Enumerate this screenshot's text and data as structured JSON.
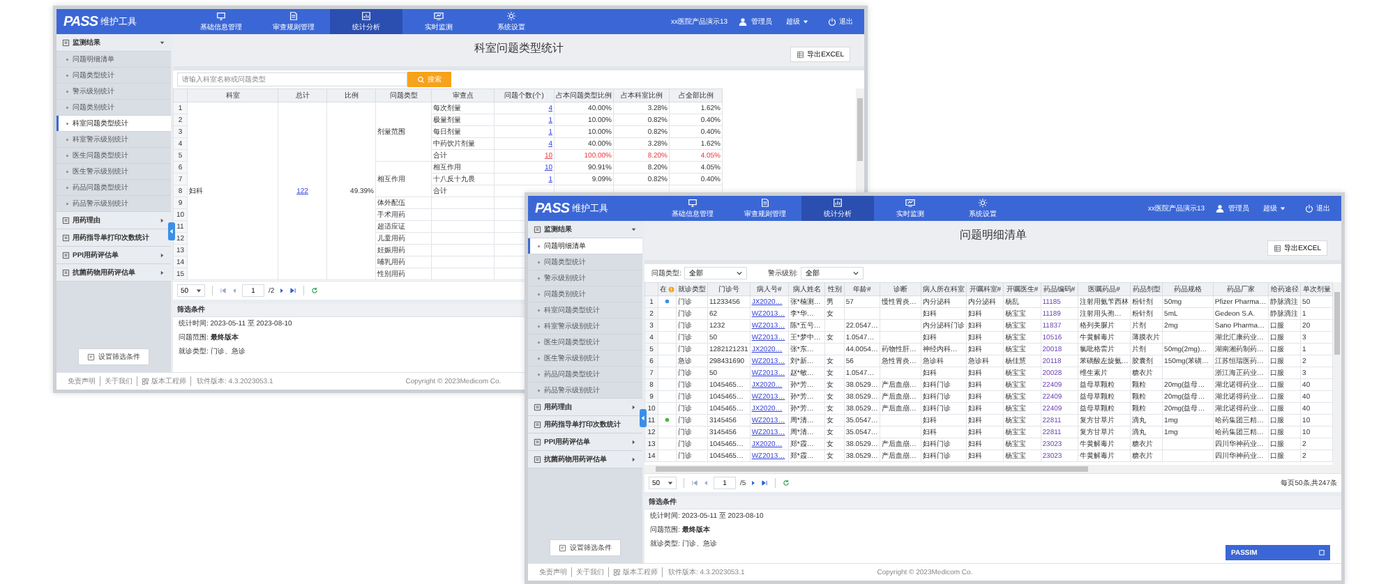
{
  "windows": [
    {
      "kind": "summary",
      "header": {
        "logo_mark": "PASS",
        "logo_text": "维护工具",
        "tabs": [
          {
            "label": "基础信息管理",
            "selected": false
          },
          {
            "label": "审查规则管理",
            "selected": false
          },
          {
            "label": "统计分析",
            "selected": true
          },
          {
            "label": "实时监测",
            "selected": false
          },
          {
            "label": "系统设置",
            "selected": false
          }
        ],
        "hospital": "xx医院产品演示13",
        "user": "管理员",
        "role": "超级",
        "logout": "退出"
      },
      "sidebar": {
        "groups": [
          {
            "label": "监测结果",
            "kind": "folder",
            "expanded": true,
            "items": [
              {
                "label": "问题明细清单",
                "selected": false
              },
              {
                "label": "问题类型统计",
                "selected": false
              },
              {
                "label": "警示级别统计",
                "selected": false
              },
              {
                "label": "问题类别统计",
                "selected": false
              },
              {
                "label": "科室问题类型统计",
                "selected": true
              },
              {
                "label": "科室警示级别统计",
                "selected": false
              },
              {
                "label": "医生问题类型统计",
                "selected": false
              },
              {
                "label": "医生警示级别统计",
                "selected": false
              },
              {
                "label": "药品问题类型统计",
                "selected": false
              },
              {
                "label": "药品警示级别统计",
                "selected": false
              }
            ]
          },
          {
            "label": "用药理由",
            "kind": "folder",
            "expanded": false
          },
          {
            "label": "用药指导单打印次数统计",
            "kind": "page"
          },
          {
            "label": "PPI用药评估单",
            "kind": "folder",
            "expanded": false
          },
          {
            "label": "抗菌药物用药评估单",
            "kind": "folder",
            "expanded": false
          }
        ],
        "button": "设置筛选条件"
      },
      "title": "科室问题类型统计",
      "export": "导出EXCEL",
      "search": {
        "placeholder": "请输入科室名称或问题类型",
        "button": "搜索"
      },
      "table": {
        "columns": [
          "科室",
          "总计",
          "比例",
          "问题类型",
          "审查点",
          "问题个数(个)",
          "占本问题类型比例",
          "占本科室比例",
          "占全部比例"
        ],
        "department": "妇科",
        "total": "122",
        "ratio": "49.39%",
        "types": [
          {
            "name": "剂量范围",
            "rows": [
              {
                "no": "1",
                "point": "每次剂量",
                "count": "4",
                "pct_type": "40.00%",
                "pct_dept": "3.28%",
                "pct_all": "1.62%"
              },
              {
                "no": "2",
                "point": "极量剂量",
                "count": "1",
                "pct_type": "10.00%",
                "pct_dept": "0.82%",
                "pct_all": "0.40%"
              },
              {
                "no": "3",
                "point": "每日剂量",
                "count": "1",
                "pct_type": "10.00%",
                "pct_dept": "0.82%",
                "pct_all": "0.40%"
              },
              {
                "no": "4",
                "point": "中药饮片剂量",
                "count": "4",
                "pct_type": "40.00%",
                "pct_dept": "3.28%",
                "pct_all": "1.62%"
              },
              {
                "no": "5",
                "point": "合计",
                "count": "10",
                "pct_type": "100.00%",
                "pct_dept": "8.20%",
                "pct_all": "4.05%",
                "kind": "total"
              }
            ]
          },
          {
            "name": "相互作用",
            "rows": [
              {
                "no": "6",
                "point": "相互作用",
                "count": "10",
                "pct_type": "90.91%",
                "pct_dept": "8.20%",
                "pct_all": "4.05%"
              },
              {
                "no": "7",
                "point": "十八反十九畏",
                "count": "1",
                "pct_type": "9.09%",
                "pct_dept": "0.82%",
                "pct_all": "0.40%"
              },
              {
                "no": "8",
                "point": "合计"
              }
            ]
          },
          {
            "name": "体外配伍",
            "rows": [
              {
                "no": "9"
              }
            ]
          },
          {
            "name": "手术用药",
            "rows": [
              {
                "no": "10"
              }
            ]
          },
          {
            "name": "超适应证",
            "rows": [
              {
                "no": "11"
              }
            ]
          },
          {
            "name": "儿童用药",
            "rows": [
              {
                "no": "12"
              }
            ]
          },
          {
            "name": "妊娠用药",
            "rows": [
              {
                "no": "13"
              }
            ]
          },
          {
            "name": "哺乳用药",
            "rows": [
              {
                "no": "14"
              }
            ]
          },
          {
            "name": "性别用药",
            "rows": [
              {
                "no": "15"
              }
            ]
          }
        ]
      },
      "pager": {
        "size": "50",
        "page": "1",
        "pages": "/2"
      },
      "conditions": {
        "heading": "筛选条件",
        "lines": [
          "统计时间: 2023-05-11 至 2023-08-10",
          "问题范围: **最终版本**",
          "就诊类型: 门诊、急诊"
        ]
      },
      "footer": {
        "links": [
          "免责声明",
          "关于我们",
          "版本工程师"
        ],
        "version": "软件版本: 4.3.2023053.1",
        "copyright": "Copyright © 2023Medicom Co."
      }
    },
    {
      "kind": "detail",
      "header": {
        "logo_mark": "PASS",
        "logo_text": "维护工具",
        "tabs": [
          {
            "label": "基础信息管理",
            "selected": false
          },
          {
            "label": "审查规则管理",
            "selected": false
          },
          {
            "label": "统计分析",
            "selected": true
          },
          {
            "label": "实时监测",
            "selected": false
          },
          {
            "label": "系统设置",
            "selected": false
          }
        ],
        "hospital": "xx医院产品演示13",
        "user": "管理员",
        "role": "超级",
        "logout": "退出"
      },
      "sidebar": {
        "groups": [
          {
            "label": "监测结果",
            "kind": "folder",
            "expanded": true,
            "items": [
              {
                "label": "问题明细清单",
                "selected": true
              },
              {
                "label": "问题类型统计",
                "selected": false
              },
              {
                "label": "警示级别统计",
                "selected": false
              },
              {
                "label": "问题类别统计",
                "selected": false
              },
              {
                "label": "科室问题类型统计",
                "selected": false
              },
              {
                "label": "科室警示级别统计",
                "selected": false
              },
              {
                "label": "医生问题类型统计",
                "selected": false
              },
              {
                "label": "医生警示级别统计",
                "selected": false
              },
              {
                "label": "药品问题类型统计",
                "selected": false
              },
              {
                "label": "药品警示级别统计",
                "selected": false
              }
            ]
          },
          {
            "label": "用药理由",
            "kind": "folder",
            "expanded": false
          },
          {
            "label": "用药指导单打印次数统计",
            "kind": "page"
          },
          {
            "label": "PPI用药评估单",
            "kind": "folder",
            "expanded": false
          },
          {
            "label": "抗菌药物用药评估单",
            "kind": "folder",
            "expanded": false
          }
        ],
        "button": "设置筛选条件"
      },
      "title": "问题明细清单",
      "export": "导出EXCEL",
      "filters": [
        {
          "label": "问题类型:",
          "value": "全部"
        },
        {
          "label": "警示级别:",
          "value": "全部"
        }
      ],
      "table": {
        "columns": [
          {
            "label": "在",
            "kind": "icon"
          },
          {
            "label": "就诊类型",
            "kind": "text"
          },
          {
            "label": "门诊号",
            "kind": "text"
          },
          {
            "label": "病人号#",
            "kind": "link"
          },
          {
            "label": "病人姓名",
            "kind": "text"
          },
          {
            "label": "性别",
            "kind": "text"
          },
          {
            "label": "年龄#",
            "kind": "text"
          },
          {
            "label": "诊断",
            "kind": "text"
          },
          {
            "label": "病人所在科室",
            "kind": "text"
          },
          {
            "label": "开嘱科室#",
            "kind": "text"
          },
          {
            "label": "开嘱医生#",
            "kind": "text"
          },
          {
            "label": "药品编码#",
            "kind": "code"
          },
          {
            "label": "医嘱药品#",
            "kind": "text"
          },
          {
            "label": "药品剂型",
            "kind": "text"
          },
          {
            "label": "药品规格",
            "kind": "text"
          },
          {
            "label": "药品厂家",
            "kind": "text"
          },
          {
            "label": "给药途径",
            "kind": "text"
          },
          {
            "label": "单次剂量",
            "kind": "text"
          }
        ],
        "rows": [
          {
            "no": "1",
            "color": "#3a8ee6",
            "cells": [
              "",
              "门诊",
              "11233456",
              "JX2020…",
              "张*楠测…",
              "男",
              "57",
              "慢性胃炎…",
              "内分泌科",
              "内分泌科",
              "杨乱",
              "11185",
              "注射用氨苄西林",
              "粉针剂",
              "50mg",
              "Pfizer Pharma…",
              "静脉滴注",
              "50"
            ]
          },
          {
            "no": "2",
            "cells": [
              "",
              "门诊",
              "62",
              "WZ2013…",
              "李*华…",
              "女",
              "",
              "",
              "妇科",
              "妇科",
              "杨宝宝",
              "11189",
              "注射用头孢…",
              "粉针剂",
              "5mL",
              "Gedeon S.A.",
              "静脉滴注",
              "1"
            ]
          },
          {
            "no": "3",
            "cells": [
              "",
              "门诊",
              "1232",
              "WZ2013…",
              "陈*五号…",
              "",
              "22.0547…",
              "",
              "内分泌科门诊",
              "妇科",
              "杨宝宝",
              "11837",
              "格列美脲片",
              "片剂",
              "2mg",
              "Sano Pharma…",
              "口服",
              "20"
            ]
          },
          {
            "no": "4",
            "cells": [
              "",
              "门诊",
              "50",
              "WZ2013…",
              "王*梦中…",
              "女",
              "1.0547…",
              "",
              "妇科",
              "妇科",
              "杨宝宝",
              "10516",
              "牛黄解毒片",
              "薄膜衣片",
              "",
              "湖北汇康药业…",
              "口服",
              "3"
            ]
          },
          {
            "no": "5",
            "cells": [
              "",
              "门诊",
              "1282121231",
              "JX2020…",
              "张*东…",
              "",
              "44.0054…",
              "药物性肝…",
              "神经内科…",
              "妇科",
              "杨宝宝",
              "20018",
              "氯吡格雷片",
              "片剂",
              "50mg(2mg)…",
              "湖南湘药制药…",
              "口服",
              "1"
            ]
          },
          {
            "no": "6",
            "cells": [
              "",
              "急诊",
              "298431690",
              "WZ2013…",
              "刘*新…",
              "女",
              "56",
              "急性胃炎…",
              "急诊科",
              "急诊科",
              "杨佳慧",
              "20118",
              "苯磺酸左旋氨…",
              "胶囊剂",
              "150mg(苯磺…",
              "江苏恒瑞医药…",
              "口服",
              "2"
            ]
          },
          {
            "no": "7",
            "cells": [
              "",
              "门诊",
              "50",
              "WZ2013…",
              "赵*敏…",
              "女",
              "1.0547…",
              "",
              "妇科",
              "妇科",
              "杨宝宝",
              "20028",
              "维生素片",
              "糖衣片",
              "",
              "浙江海正药业…",
              "口服",
              "3"
            ]
          },
          {
            "no": "8",
            "cells": [
              "",
              "门诊",
              "1045465…",
              "JX2020…",
              "孙*芳…",
              "女",
              "38.0529…",
              "产后血崩…",
              "妇科门诊",
              "妇科",
              "杨宝宝",
              "22409",
              "益母草颗粒",
              "颗粒",
              "20mg(益母…",
              "湖北诺得药业…",
              "口服",
              "40"
            ]
          },
          {
            "no": "9",
            "cells": [
              "",
              "门诊",
              "1045465…",
              "WZ2013…",
              "孙*芳…",
              "女",
              "38.0529…",
              "产后血崩…",
              "妇科门诊",
              "妇科",
              "杨宝宝",
              "22409",
              "益母草颗粒",
              "颗粒",
              "20mg(益母…",
              "湖北诺得药业…",
              "口服",
              "40"
            ]
          },
          {
            "no": "10",
            "cells": [
              "",
              "门诊",
              "1045465…",
              "JX2020…",
              "孙*芳…",
              "女",
              "38.0529…",
              "产后血崩…",
              "妇科门诊",
              "妇科",
              "杨宝宝",
              "22409",
              "益母草颗粒",
              "颗粒",
              "20mg(益母…",
              "湖北诺得药业…",
              "口服",
              "40"
            ]
          },
          {
            "no": "11",
            "color": "#52b043",
            "cells": [
              "",
              "门诊",
              "3145456",
              "WZ2013…",
              "周*清…",
              "女",
              "35.0547…",
              "",
              "妇科",
              "妇科",
              "杨宝宝",
              "22811",
              "复方甘草片",
              "滴丸",
              "1mg",
              "哈药集团三精…",
              "口服",
              "10"
            ]
          },
          {
            "no": "12",
            "cells": [
              "",
              "门诊",
              "3145456",
              "WZ2013…",
              "周*清…",
              "女",
              "35.0547…",
              "",
              "妇科",
              "妇科",
              "杨宝宝",
              "22811",
              "复方甘草片",
              "滴丸",
              "1mg",
              "哈药集团三精…",
              "口服",
              "10"
            ]
          },
          {
            "no": "13",
            "cells": [
              "",
              "门诊",
              "1045465…",
              "JX2020…",
              "郑*霞…",
              "女",
              "38.0529…",
              "产后血崩…",
              "妇科门诊",
              "妇科",
              "杨宝宝",
              "23023",
              "牛黄解毒片",
              "糖衣片",
              "",
              "四川华神药业…",
              "口服",
              "2"
            ]
          },
          {
            "no": "14",
            "cells": [
              "",
              "门诊",
              "1045465…",
              "WZ2013…",
              "郑*霞…",
              "女",
              "38.0529…",
              "产后血崩…",
              "妇科门诊",
              "妇科",
              "杨宝宝",
              "23023",
              "牛黄解毒片",
              "糖衣片",
              "",
              "四川华神药业…",
              "口服",
              "2"
            ]
          }
        ]
      },
      "pager": {
        "size": "50",
        "page": "1",
        "pages": "/5",
        "summary": "每页50条,共247条"
      },
      "conditions": {
        "heading": "筛选条件",
        "lines": [
          "统计时间: 2023-05-11 至 2023-08-10",
          "问题范围: **最终版本**",
          "就诊类型: 门诊、急诊"
        ]
      },
      "footer": {
        "links": [
          "免责声明",
          "关于我们",
          "版本工程师"
        ],
        "version": "软件版本: 4.3.2023053.1",
        "copyright": "Copyright © 2023Medicom Co."
      },
      "float_panel": "PASSIM"
    }
  ]
}
